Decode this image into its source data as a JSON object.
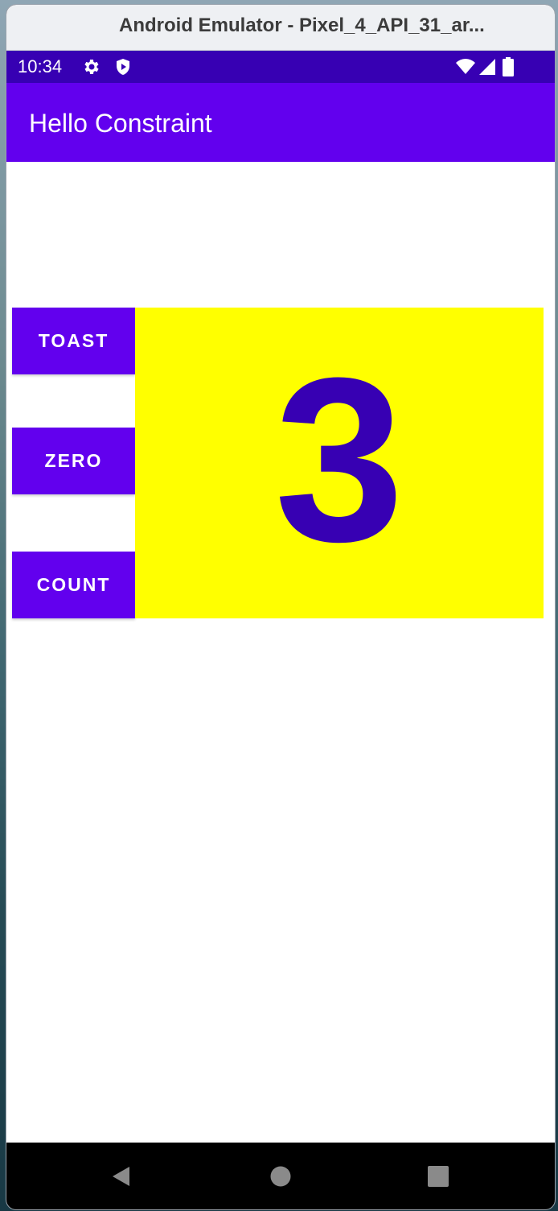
{
  "window": {
    "title": "Android Emulator - Pixel_4_API_31_ar..."
  },
  "status_bar": {
    "time": "10:34",
    "icons": [
      "gear-icon",
      "shield-play-icon",
      "wifi-icon",
      "signal-icon",
      "battery-icon"
    ]
  },
  "app_bar": {
    "title": "Hello Constraint"
  },
  "buttons": {
    "toast": "TOAST",
    "zero": "ZERO",
    "count": "COUNT"
  },
  "counter": {
    "value": "3"
  },
  "nav_bar": {
    "icons": [
      "back-icon",
      "home-icon",
      "recents-icon"
    ]
  },
  "colors": {
    "primary": "#6200ee",
    "primary_dark": "#3700b3",
    "count_background": "#ffff00",
    "count_text": "#3700b3"
  }
}
